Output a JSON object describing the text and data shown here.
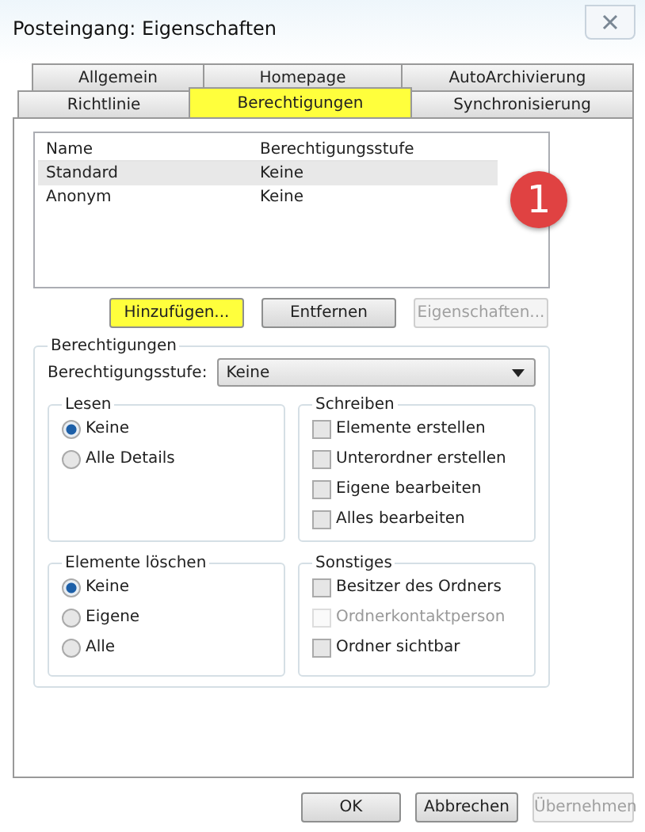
{
  "window": {
    "title": "Posteingang: Eigenschaften"
  },
  "tabs": [
    [
      {
        "label": "Allgemein",
        "selected": false,
        "highlighted": false
      },
      {
        "label": "Homepage",
        "selected": false,
        "highlighted": false
      },
      {
        "label": "AutoArchivierung",
        "selected": false,
        "highlighted": false
      }
    ],
    [
      {
        "label": "Richtlinie",
        "selected": false,
        "highlighted": false
      },
      {
        "label": "Berechtigungen",
        "selected": true,
        "highlighted": true
      },
      {
        "label": "Synchronisierung",
        "selected": false,
        "highlighted": false
      }
    ]
  ],
  "list": {
    "columns": [
      "Name",
      "Berechtigungsstufe"
    ],
    "rows": [
      {
        "cells": [
          "Standard",
          "Keine"
        ],
        "selected": true
      },
      {
        "cells": [
          "Anonym",
          "Keine"
        ],
        "selected": false
      }
    ]
  },
  "callout": {
    "label": "1"
  },
  "list_buttons": [
    {
      "label": "Hinzufügen...",
      "highlighted": true,
      "disabled": false
    },
    {
      "label": "Entfernen",
      "highlighted": false,
      "disabled": false
    },
    {
      "label": "Eigenschaften...",
      "highlighted": false,
      "disabled": true
    }
  ],
  "permissions": {
    "title": "Berechtigungen",
    "level_label": "Berechtigungsstufe:",
    "level_value": "Keine",
    "groups": [
      {
        "title": "Lesen",
        "items": [
          {
            "kind": "radio",
            "label": "Keine",
            "checked": true,
            "disabled": false
          },
          {
            "kind": "radio",
            "label": "Alle Details",
            "checked": false,
            "disabled": false
          }
        ]
      },
      {
        "title": "Schreiben",
        "items": [
          {
            "kind": "checkbox",
            "label": "Elemente erstellen",
            "checked": false,
            "disabled": false
          },
          {
            "kind": "checkbox",
            "label": "Unterordner erstellen",
            "checked": false,
            "disabled": false
          },
          {
            "kind": "checkbox",
            "label": "Eigene bearbeiten",
            "checked": false,
            "disabled": false
          },
          {
            "kind": "checkbox",
            "label": "Alles bearbeiten",
            "checked": false,
            "disabled": false
          }
        ]
      },
      {
        "title": "Elemente löschen",
        "items": [
          {
            "kind": "radio",
            "label": "Keine",
            "checked": true,
            "disabled": false
          },
          {
            "kind": "radio",
            "label": "Eigene",
            "checked": false,
            "disabled": false
          },
          {
            "kind": "radio",
            "label": "Alle",
            "checked": false,
            "disabled": false
          }
        ]
      },
      {
        "title": "Sonstiges",
        "items": [
          {
            "kind": "checkbox",
            "label": "Besitzer des Ordners",
            "checked": false,
            "disabled": false
          },
          {
            "kind": "checkbox",
            "label": "Ordnerkontaktperson",
            "checked": false,
            "disabled": true
          },
          {
            "kind": "checkbox",
            "label": "Ordner sichtbar",
            "checked": false,
            "disabled": false
          }
        ]
      }
    ]
  },
  "footer_buttons": [
    {
      "label": "OK",
      "disabled": false
    },
    {
      "label": "Abbrechen",
      "disabled": false
    },
    {
      "label": "Übernehmen",
      "disabled": true
    }
  ]
}
